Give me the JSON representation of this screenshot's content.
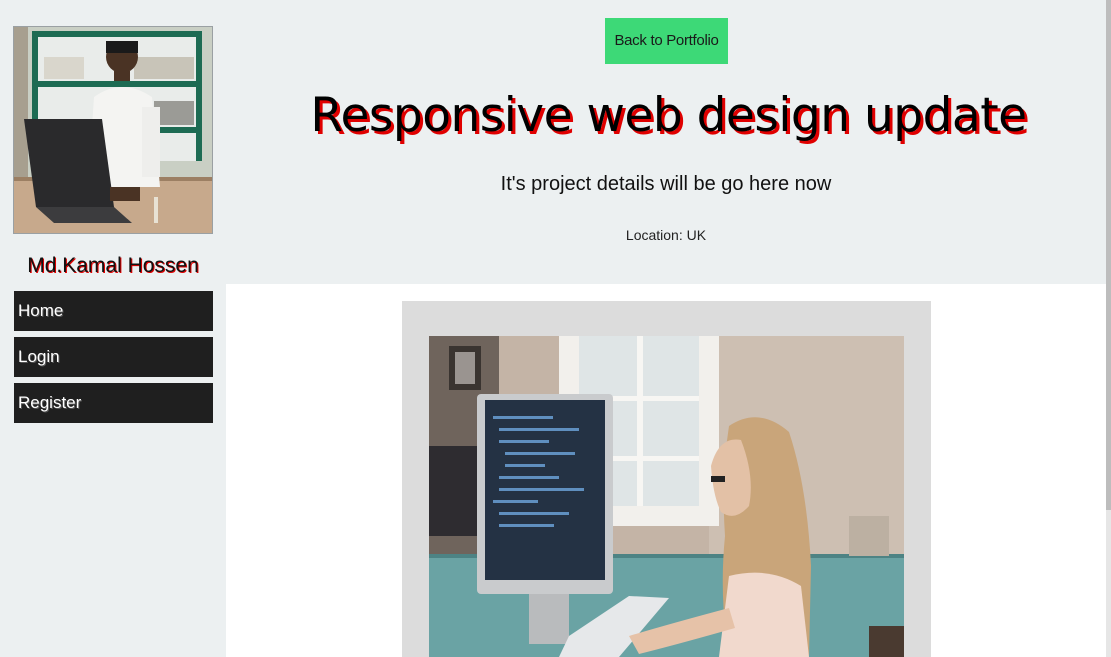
{
  "sidebar": {
    "profile_name": "Md.Kamal Hossen",
    "nav": [
      {
        "label": "Home"
      },
      {
        "label": "Login"
      },
      {
        "label": "Register"
      }
    ]
  },
  "header": {
    "back_button": "Back to Portfolio",
    "title": "Responsive web design update",
    "subtitle": "It's project details will be go here now",
    "location": "Location: UK"
  },
  "colors": {
    "background": "#ecf0f1",
    "back_button": "#3dd977",
    "nav_item": "#1f1f1f",
    "title_shadow": "#e00000"
  }
}
